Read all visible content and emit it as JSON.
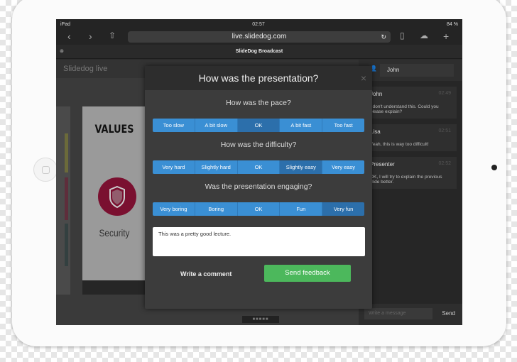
{
  "status": {
    "device": "iPad",
    "time": "02:57",
    "battery": "84 %"
  },
  "browser": {
    "url": "live.slidedog.com",
    "tab_title": "SlideDog Broadcast"
  },
  "app": {
    "title": "Slidedog live",
    "slide": {
      "heading": "VALUES",
      "caption": "Security"
    }
  },
  "chat": {
    "user": "John",
    "messages": [
      {
        "name": "John",
        "time": "02:49",
        "text": "I don't understand this. Could you please explain?"
      },
      {
        "name": "Lisa",
        "time": "02:51",
        "text": "Yeah, this is way too difficult!"
      },
      {
        "name": "Presenter",
        "time": "02:52",
        "text": "OK, I will try to explain the previous slide better."
      }
    ],
    "input_placeholder": "Write a message",
    "send_label": "Send"
  },
  "modal": {
    "title": "How was the presentation?",
    "close": "×",
    "questions": [
      {
        "label": "How was the pace?",
        "options": [
          "Too slow",
          "A bit slow",
          "OK",
          "A bit fast",
          "Too fast"
        ],
        "selected": "OK"
      },
      {
        "label": "How was the difficulty?",
        "options": [
          "Very hard",
          "Slightly hard",
          "OK",
          "Slightly easy",
          "Very easy"
        ],
        "selected": "Slightly easy"
      },
      {
        "label": "Was the presentation engaging?",
        "options": [
          "Very boring",
          "Boring",
          "OK",
          "Fun",
          "Very fun"
        ],
        "selected": "Very fun"
      }
    ],
    "comment": "This was a pretty good lecture.",
    "write_comment_label": "Write a comment",
    "send_label": "Send feedback"
  },
  "colors": {
    "accent": "#3a8fd4",
    "selected": "#2c6fab",
    "send": "#4cb85c"
  }
}
